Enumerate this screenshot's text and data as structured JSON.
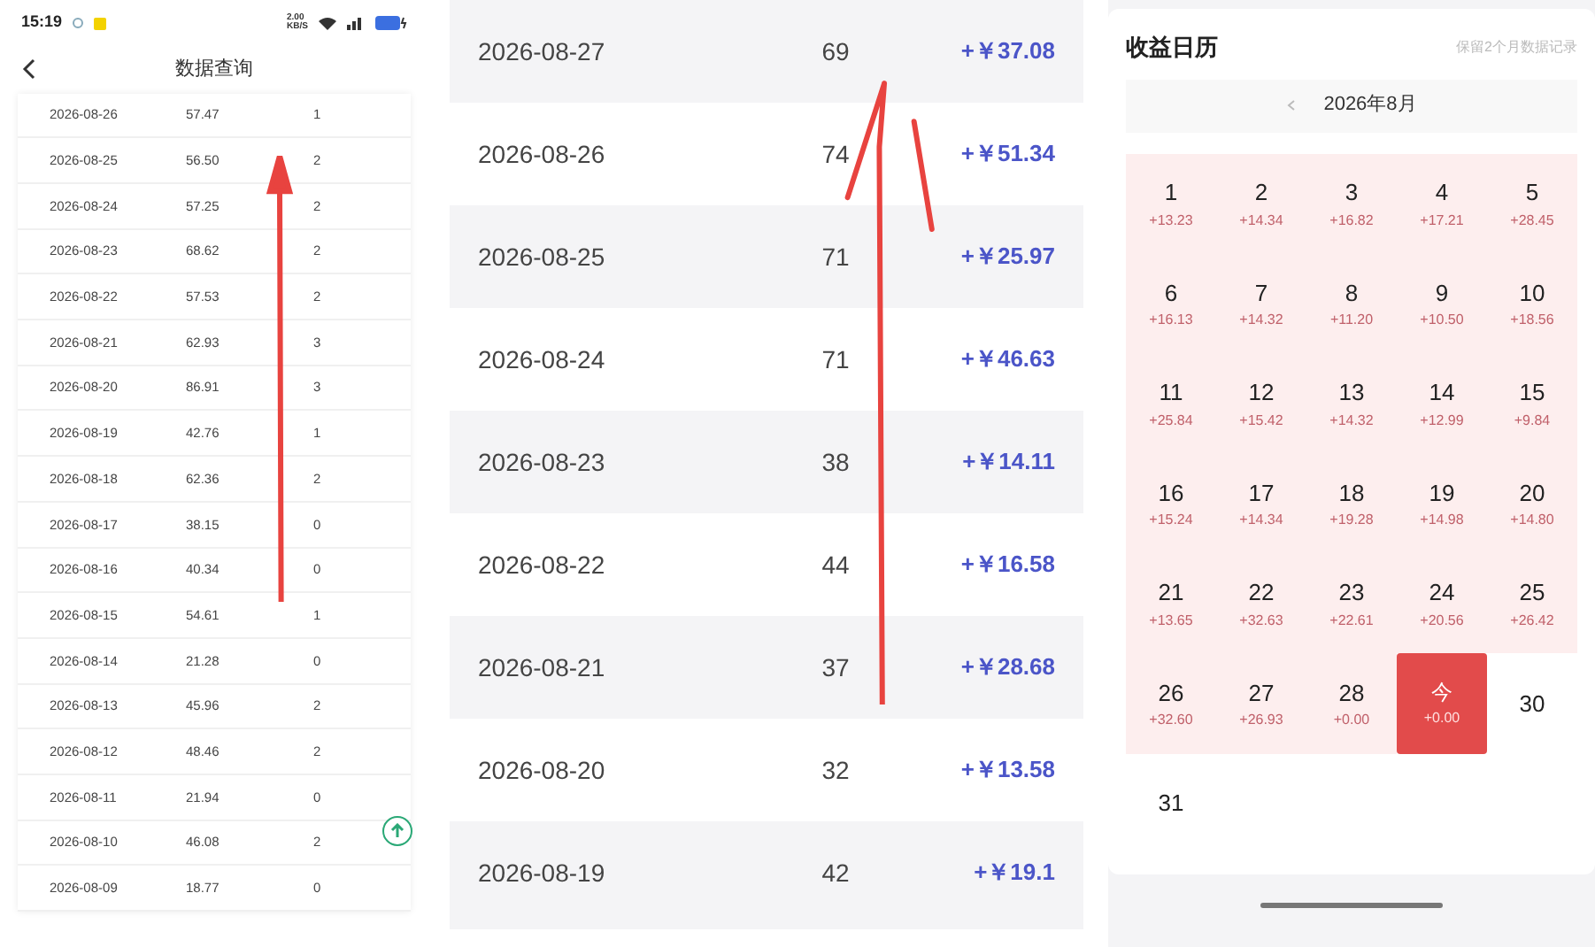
{
  "phone_status": {
    "time": "15:19",
    "network": "2.00 KB/S"
  },
  "query_page": {
    "title": "数据查询",
    "rows": [
      {
        "date": "2026-08-26",
        "value": "57.47",
        "count": "1"
      },
      {
        "date": "2026-08-25",
        "value": "56.50",
        "count": "2"
      },
      {
        "date": "2026-08-24",
        "value": "57.25",
        "count": "2"
      },
      {
        "date": "2026-08-23",
        "value": "68.62",
        "count": "2"
      },
      {
        "date": "2026-08-22",
        "value": "57.53",
        "count": "2"
      },
      {
        "date": "2026-08-21",
        "value": "62.93",
        "count": "3"
      },
      {
        "date": "2026-08-20",
        "value": "86.91",
        "count": "3"
      },
      {
        "date": "2026-08-19",
        "value": "42.76",
        "count": "1"
      },
      {
        "date": "2026-08-18",
        "value": "62.36",
        "count": "2"
      },
      {
        "date": "2026-08-17",
        "value": "38.15",
        "count": "0"
      },
      {
        "date": "2026-08-16",
        "value": "40.34",
        "count": "0"
      },
      {
        "date": "2026-08-15",
        "value": "54.61",
        "count": "1"
      },
      {
        "date": "2026-08-14",
        "value": "21.28",
        "count": "0"
      },
      {
        "date": "2026-08-13",
        "value": "45.96",
        "count": "2"
      },
      {
        "date": "2026-08-12",
        "value": "48.46",
        "count": "2"
      },
      {
        "date": "2026-08-11",
        "value": "21.94",
        "count": "0"
      },
      {
        "date": "2026-08-10",
        "value": "46.08",
        "count": "2"
      },
      {
        "date": "2026-08-09",
        "value": "18.77",
        "count": "0"
      }
    ]
  },
  "earnings_list": {
    "rows": [
      {
        "date": "2026-08-27",
        "count": "69",
        "amount": "+￥37.08"
      },
      {
        "date": "2026-08-26",
        "count": "74",
        "amount": "+￥51.34"
      },
      {
        "date": "2026-08-25",
        "count": "71",
        "amount": "+￥25.97"
      },
      {
        "date": "2026-08-24",
        "count": "71",
        "amount": "+￥46.63"
      },
      {
        "date": "2026-08-23",
        "count": "38",
        "amount": "+￥14.11"
      },
      {
        "date": "2026-08-22",
        "count": "44",
        "amount": "+￥16.58"
      },
      {
        "date": "2026-08-21",
        "count": "37",
        "amount": "+￥28.68"
      },
      {
        "date": "2026-08-20",
        "count": "32",
        "amount": "+￥13.58"
      },
      {
        "date": "2026-08-19",
        "count": "42",
        "amount": "+￥19.1"
      }
    ]
  },
  "calendar": {
    "title": "收益日历",
    "note": "保留2个月数据记录",
    "month": "2026年8月",
    "days": [
      {
        "kind": "earned",
        "day": "1",
        "amount": "+13.23"
      },
      {
        "kind": "earned",
        "day": "2",
        "amount": "+14.34"
      },
      {
        "kind": "earned",
        "day": "3",
        "amount": "+16.82"
      },
      {
        "kind": "earned",
        "day": "4",
        "amount": "+17.21"
      },
      {
        "kind": "earned",
        "day": "5",
        "amount": "+28.45"
      },
      {
        "kind": "earned",
        "day": "6",
        "amount": "+16.13"
      },
      {
        "kind": "earned",
        "day": "7",
        "amount": "+14.32"
      },
      {
        "kind": "earned",
        "day": "8",
        "amount": "+11.20"
      },
      {
        "kind": "earned",
        "day": "9",
        "amount": "+10.50"
      },
      {
        "kind": "earned",
        "day": "10",
        "amount": "+18.56"
      },
      {
        "kind": "earned",
        "day": "11",
        "amount": "+25.84"
      },
      {
        "kind": "earned",
        "day": "12",
        "amount": "+15.42"
      },
      {
        "kind": "earned",
        "day": "13",
        "amount": "+14.32"
      },
      {
        "kind": "earned",
        "day": "14",
        "amount": "+12.99"
      },
      {
        "kind": "earned",
        "day": "15",
        "amount": "+9.84"
      },
      {
        "kind": "earned",
        "day": "16",
        "amount": "+15.24"
      },
      {
        "kind": "earned",
        "day": "17",
        "amount": "+14.34"
      },
      {
        "kind": "earned",
        "day": "18",
        "amount": "+19.28"
      },
      {
        "kind": "earned",
        "day": "19",
        "amount": "+14.98"
      },
      {
        "kind": "earned",
        "day": "20",
        "amount": "+14.80"
      },
      {
        "kind": "earned",
        "day": "21",
        "amount": "+13.65"
      },
      {
        "kind": "earned",
        "day": "22",
        "amount": "+32.63"
      },
      {
        "kind": "earned",
        "day": "23",
        "amount": "+22.61"
      },
      {
        "kind": "earned",
        "day": "24",
        "amount": "+20.56"
      },
      {
        "kind": "earned",
        "day": "25",
        "amount": "+26.42"
      },
      {
        "kind": "earned",
        "day": "26",
        "amount": "+32.60"
      },
      {
        "kind": "earned",
        "day": "27",
        "amount": "+26.93"
      },
      {
        "kind": "earned",
        "day": "28",
        "amount": "+0.00"
      },
      {
        "kind": "today",
        "day": "今",
        "amount": "+0.00"
      },
      {
        "kind": "plain",
        "day": "30"
      },
      {
        "kind": "plain",
        "day": "31"
      }
    ]
  }
}
